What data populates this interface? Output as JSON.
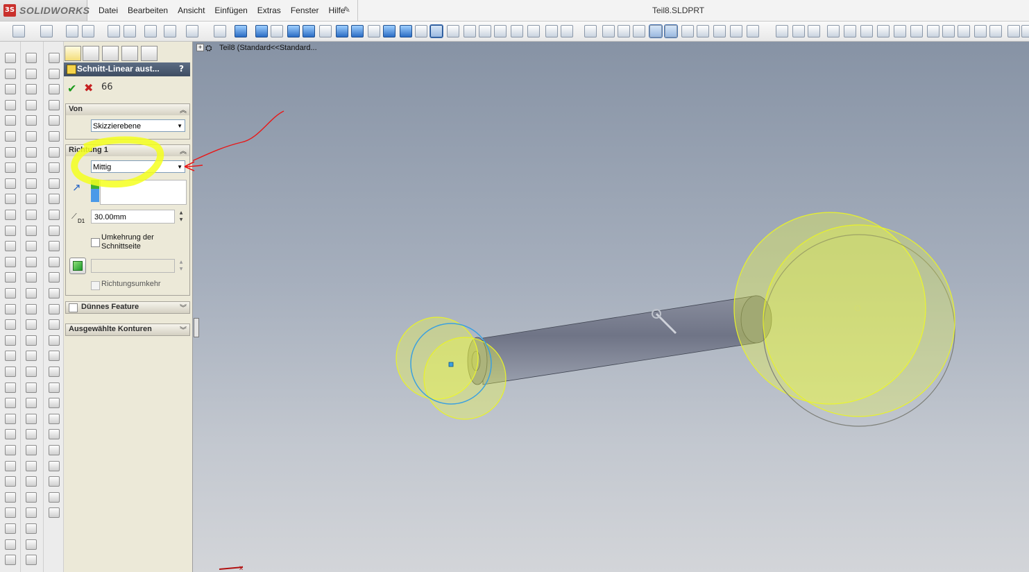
{
  "app": {
    "logo_prefix": "3S",
    "name": "SOLIDWORKS",
    "document": "Teil8.SLDPRT"
  },
  "menu": [
    "Datei",
    "Bearbeiten",
    "Ansicht",
    "Einfügen",
    "Extras",
    "Fenster",
    "Hilfe"
  ],
  "feature_tree": {
    "item": "Teil8  (Standard<<Standard..."
  },
  "property_manager": {
    "title": "Schnitt-Linear aust...",
    "help": "?",
    "ok": "✔",
    "cancel": "✖",
    "preview": "66",
    "groups": {
      "von": {
        "label": "Von",
        "combo_value": "Skizzierebene"
      },
      "richtung1": {
        "label": "Richtung 1",
        "combo_value": "Mittig",
        "depth_prefix": "D1",
        "depth_value": "30.00mm",
        "reverse_side_label_1": "Umkehrung der",
        "reverse_side_label_2": "Schnittseite",
        "direction_reverse_label": "Richtungsumkehr"
      },
      "thin_feature": {
        "label": "Dünnes Feature"
      },
      "contours": {
        "label": "Ausgewählte Konturen"
      }
    }
  },
  "axis_label": "x",
  "colors": {
    "viewport_top": "#8793a5",
    "viewport_bottom": "#d3d5d9",
    "highlight": "#f2ff3a",
    "annotation": "#e81818",
    "sketch": "#3aa0e0"
  }
}
